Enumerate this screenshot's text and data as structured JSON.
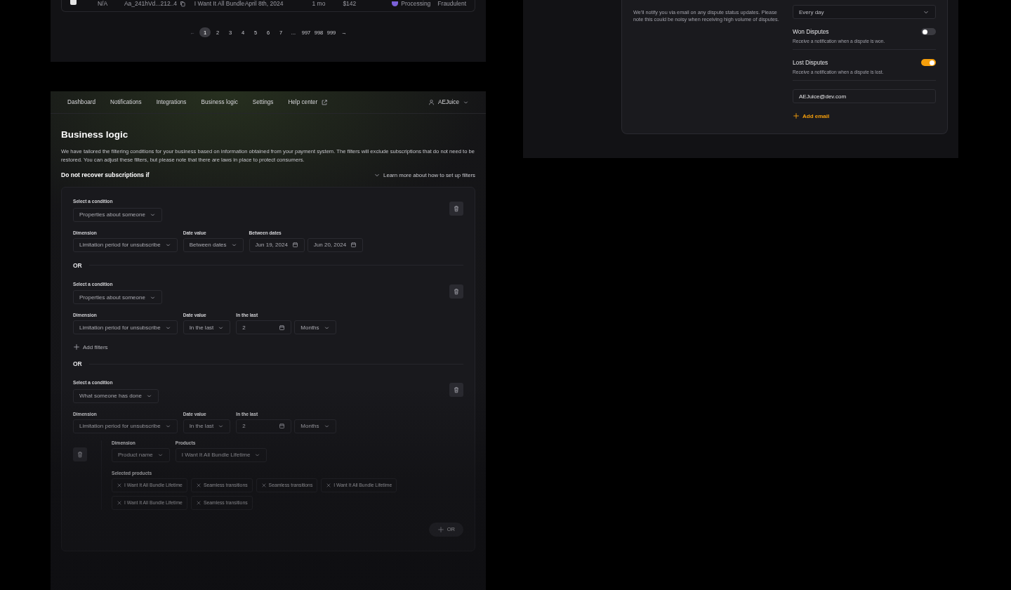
{
  "table_panel": {
    "row": {
      "checked": true,
      "cells": [
        "N/A",
        "Aa_241hVd...212..4",
        "I Want It All Bundle",
        "April 8th, 2024",
        "1 mo",
        "$142"
      ],
      "status": {
        "label": "Processing",
        "color": "#7b61d9"
      },
      "reason": "Fraudulent"
    },
    "pagination": {
      "prev": "←",
      "next": "→",
      "pages": [
        {
          "label": "1",
          "selected": true
        },
        {
          "label": "2",
          "selected": false
        },
        {
          "label": "3",
          "selected": false
        },
        {
          "label": "4",
          "selected": false
        },
        {
          "label": "5",
          "selected": false
        },
        {
          "label": "6",
          "selected": false
        },
        {
          "label": "7",
          "selected": false
        },
        {
          "label": "...",
          "selected": false
        },
        {
          "label": "997",
          "selected": false
        },
        {
          "label": "998",
          "selected": false
        },
        {
          "label": "999",
          "selected": false
        }
      ]
    }
  },
  "notifications_panel": {
    "description": "We'll notify you via email on any dispute status updates. Please note this could be noisy when receiving high volume of disputes.",
    "frequency": "Every day",
    "toggles": [
      {
        "title": "Won Disputes",
        "description": "Receive a notification when a dispute is won.",
        "on": false
      },
      {
        "title": "Lost Disputes",
        "description": "Receive a notification when a dispute is lost.",
        "on": true
      }
    ],
    "email": "AEJuice@dev.com",
    "add_email": "Add email"
  },
  "main": {
    "nav": [
      {
        "label": "Dashboard",
        "external": false
      },
      {
        "label": "Notifications",
        "external": false
      },
      {
        "label": "Integrations",
        "external": false
      },
      {
        "label": "Business logic",
        "external": false
      },
      {
        "label": "Settings",
        "external": false
      },
      {
        "label": "Help center",
        "external": true
      }
    ],
    "user": "AEJuice",
    "title": "Business logic",
    "description": "We have tailored the filtering conditions for your business based on information obtained from your payment system. The filters will exclude subscriptions that do not need to be restored. You can adjust these filters, but please note that there are laws in place to protect consumers.",
    "section_title": "Do not recover subscriptions if",
    "learn_more": "Learn more about how to set up filters",
    "groups": [
      {
        "condition_label": "Select a condition",
        "condition": "Properties about someone",
        "fields": [
          {
            "label": "Dimension",
            "controls": [
              {
                "kind": "select",
                "value": "Limitation period for unsubscribe"
              }
            ]
          },
          {
            "label": "Date value",
            "controls": [
              {
                "kind": "select",
                "value": "Between dates"
              }
            ]
          },
          {
            "label": "Between dates",
            "controls": [
              {
                "kind": "date",
                "value": "Jun 19, 2024"
              },
              {
                "kind": "date",
                "value": "Jun 20, 2024"
              }
            ]
          }
        ]
      },
      {
        "separator": "OR",
        "condition_label": "Select a condition",
        "condition": "Properties about someone",
        "fields": [
          {
            "label": "Dimension",
            "controls": [
              {
                "kind": "select",
                "value": "Limitation period for unsubscribe"
              }
            ]
          },
          {
            "label": "Date value",
            "controls": [
              {
                "kind": "select",
                "value": "In the last"
              }
            ]
          },
          {
            "label": "In the last",
            "controls": [
              {
                "kind": "date",
                "value": "2"
              },
              {
                "kind": "select",
                "value": "Months"
              }
            ]
          }
        ],
        "add_filters": "Add filters"
      },
      {
        "separator": "OR",
        "condition_label": "Select a condition",
        "condition": "What someone has done",
        "fields": [
          {
            "label": "Dimension",
            "controls": [
              {
                "kind": "select",
                "value": "Limitation period for unsubscribe"
              }
            ]
          },
          {
            "label": "Date value",
            "controls": [
              {
                "kind": "select",
                "value": "In the last"
              }
            ]
          },
          {
            "label": "In the last",
            "controls": [
              {
                "kind": "date",
                "value": "2"
              },
              {
                "kind": "select",
                "value": "Months"
              }
            ]
          }
        ],
        "subfilter": {
          "fields": [
            {
              "label": "Dimension",
              "controls": [
                {
                  "kind": "select",
                  "value": "Product name"
                }
              ]
            },
            {
              "label": "Products",
              "controls": [
                {
                  "kind": "select",
                  "value": "I Want It All Bundle Lifetime"
                }
              ]
            }
          ],
          "selected_label": "Selected products",
          "tags": [
            "I Want It All Bundle Lifetime",
            "Seamless transitions",
            "Seamless transitions",
            "I Want It All Bundle Lifetime",
            "I Want It All Bundle Lifetime",
            "Seamless transitions"
          ]
        }
      }
    ],
    "add_or": "OR"
  }
}
